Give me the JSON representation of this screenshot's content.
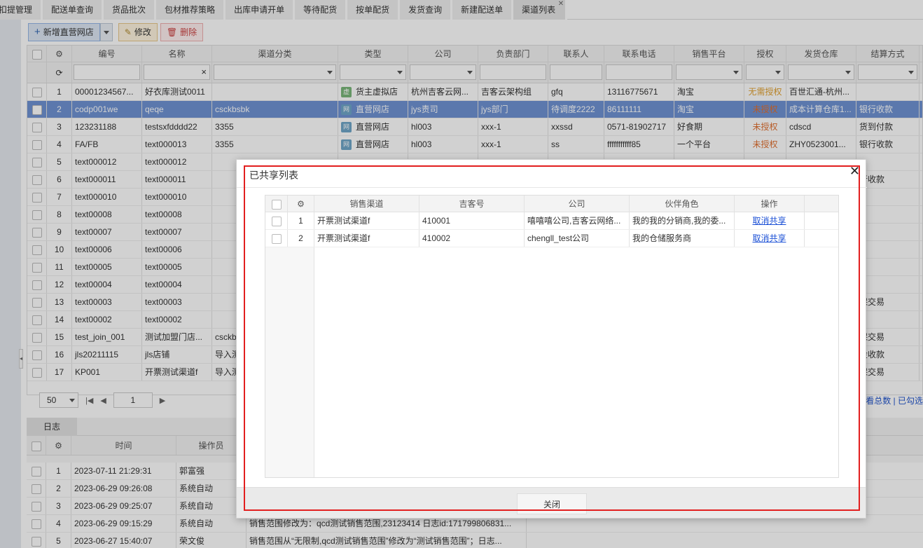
{
  "tabs": [
    "扣提管理",
    "配送单查询",
    "货品批次",
    "包材推荐策略",
    "出库申请开单",
    "等待配货",
    "按单配货",
    "发货查询",
    "新建配送单",
    "渠道列表"
  ],
  "toolbar": {
    "add": "新增直营网店",
    "edit": "修改",
    "delete": "删除"
  },
  "grid": {
    "headers": [
      "编号",
      "名称",
      "渠道分类",
      "类型",
      "公司",
      "负责部门",
      "联系人",
      "联系电话",
      "销售平台",
      "授权",
      "发货仓库",
      "结算方式"
    ],
    "rows": [
      [
        "1",
        "00001234567...",
        "好衣库测试0011",
        "",
        "货主虚拟店",
        "杭州吉客云网...",
        "吉客云架构组",
        "gfq",
        "13116775671",
        "淘宝",
        "无需授权",
        "百世汇通-杭州...",
        ""
      ],
      [
        "2",
        "codp001we",
        "qeqe",
        "csckbsbk",
        "直营网店",
        "jys责司",
        "jys部门",
        "待调度2222",
        "86111111",
        "淘宝",
        "未授权",
        "成本计算仓库1...",
        "银行收款"
      ],
      [
        "3",
        "123231188",
        "testsxfdddd22",
        "3355",
        "直营网店",
        "hl003",
        "xxx-1",
        "xxssd",
        "0571-81902717",
        "好食期",
        "未授权",
        "cdscd",
        "货到付款"
      ],
      [
        "4",
        "FA/FB",
        "text000013",
        "3355",
        "直营网店",
        "hl003",
        "xxx-1",
        "ss",
        "fffffffffff85",
        "一个平台",
        "未授权",
        "ZHY0523001...",
        "银行收款"
      ],
      [
        "5",
        "text000012",
        "text000012",
        "",
        "",
        "",
        "",
        "",
        "",
        "",
        "",
        "",
        ""
      ],
      [
        "6",
        "text000011",
        "text000011",
        "",
        "",
        "",
        "",
        "",
        "",
        "",
        "",
        "",
        "行收款"
      ],
      [
        "7",
        "text000010",
        "text000010",
        "",
        "",
        "",
        "",
        "",
        "",
        "",
        "",
        "",
        ""
      ],
      [
        "8",
        "text00008",
        "text00008",
        "",
        "",
        "",
        "",
        "",
        "",
        "",
        "",
        "",
        ""
      ],
      [
        "9",
        "text00007",
        "text00007",
        "",
        "",
        "",
        "",
        "",
        "",
        "",
        "",
        "",
        ""
      ],
      [
        "10",
        "text00006",
        "text00006",
        "",
        "",
        "",
        "",
        "",
        "",
        "",
        "",
        "",
        ""
      ],
      [
        "11",
        "text00005",
        "text00005",
        "",
        "",
        "",
        "",
        "",
        "",
        "",
        "",
        "",
        ""
      ],
      [
        "12",
        "text00004",
        "text00004",
        "",
        "",
        "",
        "",
        "",
        "",
        "",
        "",
        "",
        ""
      ],
      [
        "13",
        "text00003",
        "text00003",
        "",
        "",
        "",
        "",
        "",
        "",
        "",
        "",
        "",
        "保交易"
      ],
      [
        "14",
        "text00002",
        "text00002",
        "",
        "",
        "",
        "",
        "",
        "",
        "",
        "",
        "",
        ""
      ],
      [
        "15",
        "test_join_001",
        "测试加盟门店...",
        "csckbs",
        "",
        "",
        "",
        "",
        "",
        "",
        "",
        "",
        "保交易"
      ],
      [
        "16",
        "jls20211115",
        "jls店铺",
        "导入测",
        "",
        "",
        "",
        "",
        "",
        "",
        "",
        "",
        "金收款"
      ],
      [
        "17",
        "KP001",
        "开票测试渠道f",
        "导入测",
        "",
        "",
        "",
        "",
        "",
        "",
        "",
        "",
        "保交易"
      ]
    ]
  },
  "pager": {
    "size": "50",
    "page": "1",
    "right": "看总数 | 已勾选"
  },
  "log": {
    "tab": "日志",
    "headers": [
      "时间",
      "操作员"
    ],
    "rows": [
      [
        "1",
        "2023-07-11 21:29:31",
        "郭富强",
        ""
      ],
      [
        "2",
        "2023-06-29 09:26:08",
        "系统自动",
        ""
      ],
      [
        "3",
        "2023-06-29 09:25:07",
        "系统自动",
        ""
      ],
      [
        "4",
        "2023-06-29 09:15:29",
        "系统自动",
        "销售范围修改为：qcd测试销售范围,23123414 日志id:171799806831..."
      ],
      [
        "5",
        "2023-06-27 15:40:07",
        "荣文俊",
        "销售范围从“无限制,qcd测试销售范围”修改为“测试销售范围”；日志..."
      ]
    ]
  },
  "dialog": {
    "title": "已共享列表",
    "headers": [
      "销售渠道",
      "吉客号",
      "公司",
      "伙伴角色",
      "操作"
    ],
    "rows": [
      [
        "1",
        "开票测试渠道f",
        "410001",
        "嘻嘻嘻公司,吉客云网络...",
        "我的我的分销商,我的委...",
        "取消共享"
      ],
      [
        "2",
        "开票测试渠道f",
        "410002",
        "chengll_test公司",
        "我的仓储服务商",
        "取消共享"
      ]
    ],
    "close": "关闭"
  }
}
